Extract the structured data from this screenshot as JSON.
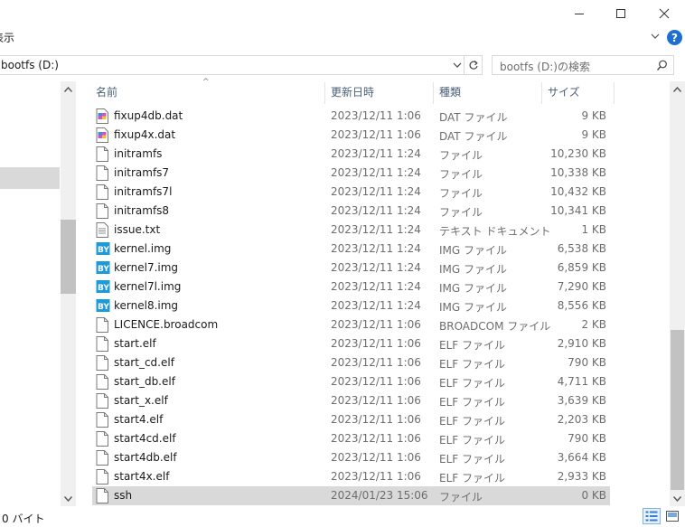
{
  "window": {
    "controls": [
      "minimize",
      "maximize",
      "close"
    ]
  },
  "ribbon": {
    "view_label": "表示",
    "help_label": "?"
  },
  "address": {
    "path": "bootfs (D:)",
    "search_placeholder": "bootfs (D:)の検索"
  },
  "columns": {
    "name": "名前",
    "date": "更新日時",
    "type": "種類",
    "size": "サイズ"
  },
  "files": [
    {
      "name": "fixup4db.dat",
      "date": "2023/12/11 1:06",
      "type": "DAT ファイル",
      "size": "9 KB",
      "icon": "dat-file-icon"
    },
    {
      "name": "fixup4x.dat",
      "date": "2023/12/11 1:06",
      "type": "DAT ファイル",
      "size": "9 KB",
      "icon": "dat-file-icon"
    },
    {
      "name": "initramfs",
      "date": "2023/12/11 1:24",
      "type": "ファイル",
      "size": "10,230 KB",
      "icon": "blank-file-icon"
    },
    {
      "name": "initramfs7",
      "date": "2023/12/11 1:24",
      "type": "ファイル",
      "size": "10,338 KB",
      "icon": "blank-file-icon"
    },
    {
      "name": "initramfs7l",
      "date": "2023/12/11 1:24",
      "type": "ファイル",
      "size": "10,432 KB",
      "icon": "blank-file-icon"
    },
    {
      "name": "initramfs8",
      "date": "2023/12/11 1:24",
      "type": "ファイル",
      "size": "10,341 KB",
      "icon": "blank-file-icon"
    },
    {
      "name": "issue.txt",
      "date": "2023/12/11 1:24",
      "type": "テキスト ドキュメント",
      "size": "1 KB",
      "icon": "text-file-icon"
    },
    {
      "name": "kernel.img",
      "date": "2023/12/11 1:24",
      "type": "IMG ファイル",
      "size": "6,538 KB",
      "icon": "img-file-icon"
    },
    {
      "name": "kernel7.img",
      "date": "2023/12/11 1:24",
      "type": "IMG ファイル",
      "size": "6,859 KB",
      "icon": "img-file-icon"
    },
    {
      "name": "kernel7l.img",
      "date": "2023/12/11 1:24",
      "type": "IMG ファイル",
      "size": "7,290 KB",
      "icon": "img-file-icon"
    },
    {
      "name": "kernel8.img",
      "date": "2023/12/11 1:24",
      "type": "IMG ファイル",
      "size": "8,556 KB",
      "icon": "img-file-icon"
    },
    {
      "name": "LICENCE.broadcom",
      "date": "2023/12/11 1:06",
      "type": "BROADCOM ファイル",
      "size": "2 KB",
      "icon": "blank-file-icon"
    },
    {
      "name": "start.elf",
      "date": "2023/12/11 1:06",
      "type": "ELF ファイル",
      "size": "2,910 KB",
      "icon": "blank-file-icon"
    },
    {
      "name": "start_cd.elf",
      "date": "2023/12/11 1:06",
      "type": "ELF ファイル",
      "size": "790 KB",
      "icon": "blank-file-icon"
    },
    {
      "name": "start_db.elf",
      "date": "2023/12/11 1:06",
      "type": "ELF ファイル",
      "size": "4,711 KB",
      "icon": "blank-file-icon"
    },
    {
      "name": "start_x.elf",
      "date": "2023/12/11 1:06",
      "type": "ELF ファイル",
      "size": "3,639 KB",
      "icon": "blank-file-icon"
    },
    {
      "name": "start4.elf",
      "date": "2023/12/11 1:06",
      "type": "ELF ファイル",
      "size": "2,203 KB",
      "icon": "blank-file-icon"
    },
    {
      "name": "start4cd.elf",
      "date": "2023/12/11 1:06",
      "type": "ELF ファイル",
      "size": "790 KB",
      "icon": "blank-file-icon"
    },
    {
      "name": "start4db.elf",
      "date": "2023/12/11 1:06",
      "type": "ELF ファイル",
      "size": "3,664 KB",
      "icon": "blank-file-icon"
    },
    {
      "name": "start4x.elf",
      "date": "2023/12/11 1:06",
      "type": "ELF ファイル",
      "size": "2,933 KB",
      "icon": "blank-file-icon"
    },
    {
      "name": "ssh",
      "date": "2024/01/23 15:06",
      "type": "ファイル",
      "size": "0 KB",
      "icon": "blank-file-icon",
      "selected": true
    }
  ],
  "status": {
    "text": "0 バイト"
  },
  "colors": {
    "accent": "#1e6fd0",
    "selection": "#d9d9d9",
    "header_text": "#4c607a"
  }
}
